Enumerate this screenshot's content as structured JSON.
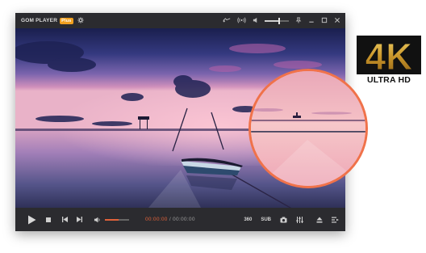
{
  "app": {
    "title": "GOM PLAYER",
    "badge": "Plus"
  },
  "titlebar": {
    "icons": [
      "gear-icon",
      "cast-icon",
      "broadcast-icon",
      "pin-icon",
      "minimize-icon",
      "maximize-icon",
      "close-icon"
    ]
  },
  "video": {
    "scene": "sunset-lake-boat"
  },
  "zoom": {
    "accent": "#f0724a"
  },
  "controls": {
    "time_current": "00:00:00",
    "time_separator": "/",
    "time_total": "00:00:00",
    "btn_360": "360",
    "btn_sub": "SUB",
    "accent": "#e0623a",
    "volume_level": 0.55
  },
  "branding": {
    "logo_text": "4K",
    "ultra_hd": "ULTRA HD"
  }
}
